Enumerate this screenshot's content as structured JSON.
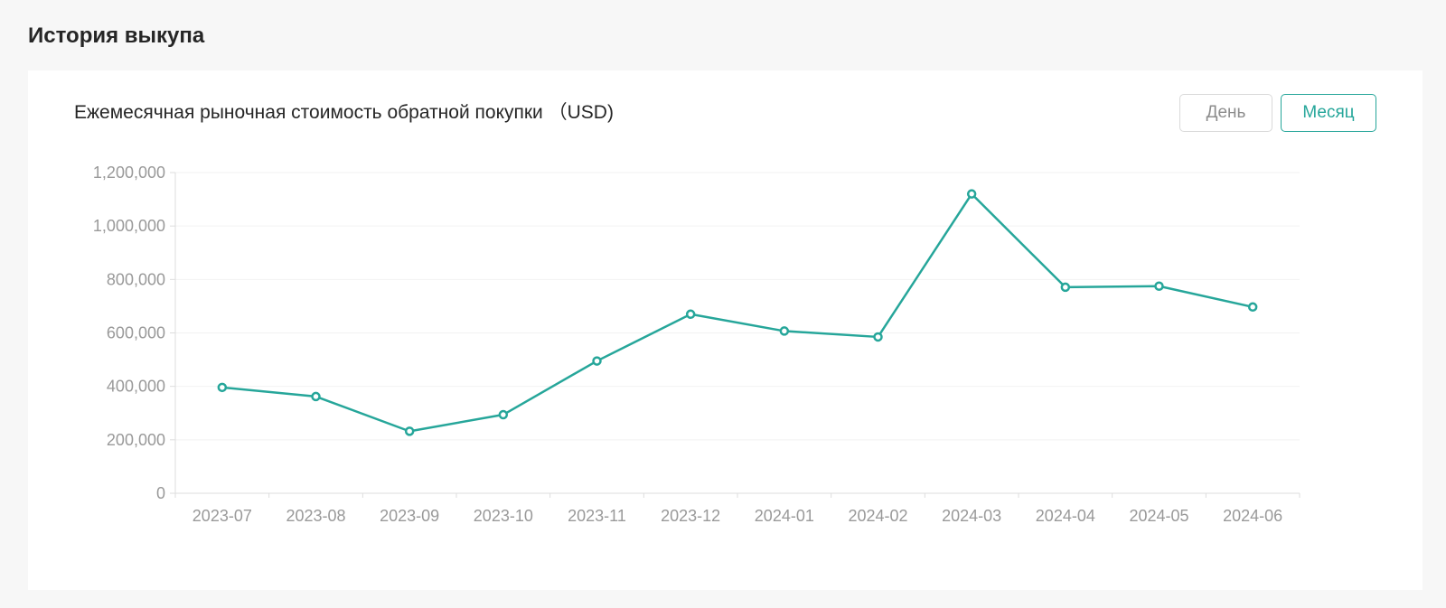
{
  "section": {
    "title": "История выкупа"
  },
  "card": {
    "chart_title": "Ежемесячная рыночная стоимость обратной покупки （USD)"
  },
  "toggle": {
    "day_label": "День",
    "month_label": "Месяц",
    "active": "month"
  },
  "colors": {
    "line": "#26a69a",
    "axis_text": "#999999",
    "grid": "#f2f2f2"
  },
  "chart_data": {
    "type": "line",
    "title": "Ежемесячная рыночная стоимость обратной покупки （USD)",
    "categories": [
      "2023-07",
      "2023-08",
      "2023-09",
      "2023-10",
      "2023-11",
      "2023-12",
      "2024-01",
      "2024-02",
      "2024-03",
      "2024-04",
      "2024-05",
      "2024-06"
    ],
    "series": [
      {
        "values": [
          396000,
          362000,
          232000,
          294000,
          495000,
          670000,
          607000,
          585000,
          1120000,
          771000,
          775000,
          697000
        ]
      }
    ],
    "yticks": [
      "0",
      "200,000",
      "400,000",
      "600,000",
      "800,000",
      "1,000,000",
      "1,200,000"
    ],
    "ylim": [
      0,
      1200000
    ],
    "grid": true
  }
}
